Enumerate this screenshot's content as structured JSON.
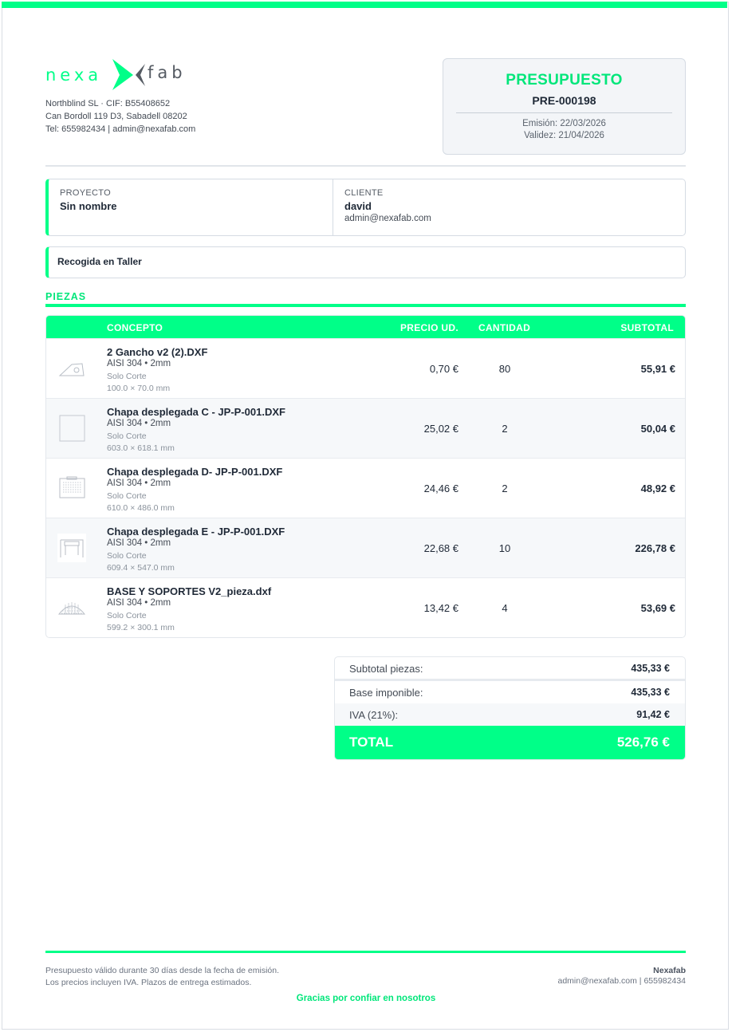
{
  "brand": {
    "logo_left": "nexa",
    "logo_right": "fab",
    "accent_color": "#00ff88"
  },
  "company": {
    "line1": "Northblind SL · CIF: B55408652",
    "line2": "Can Bordoll 119 D3, Sabadell 08202",
    "line3": "Tel: 655982434 | admin@nexafab.com"
  },
  "quote": {
    "title": "PRESUPUESTO",
    "number": "PRE-000198",
    "issued": "Emisión: 22/03/2026",
    "valid": "Validez: 21/04/2026"
  },
  "project": {
    "label": "PROYECTO",
    "value": "Sin nombre"
  },
  "client": {
    "label": "CLIENTE",
    "name": "david",
    "email": "admin@nexafab.com"
  },
  "shipping": {
    "method": "Recogida en Taller"
  },
  "parts_section": {
    "title": "PIEZAS"
  },
  "table": {
    "headers": {
      "concept": "CONCEPTO",
      "unit_price": "PRECIO UD.",
      "quantity": "CANTIDAD",
      "subtotal": "SUBTOTAL"
    },
    "rows": [
      {
        "name": "2 Gancho v2 (2).DXF",
        "material": "AISI 304 • 2mm",
        "process": "Solo Corte",
        "dimensions": "100.0 × 70.0 mm",
        "unit_price": "0,70 €",
        "quantity": "80",
        "subtotal": "55,91 €",
        "thumb_icon": "hook-part-icon"
      },
      {
        "name": "Chapa desplegada C - JP-P-001.DXF",
        "material": "AISI 304 • 2mm",
        "process": "Solo Corte",
        "dimensions": "603.0 × 618.1 mm",
        "unit_price": "25,02 €",
        "quantity": "2",
        "subtotal": "50,04 €",
        "thumb_icon": "square-sheet-icon"
      },
      {
        "name": "Chapa desplegada D- JP-P-001.DXF",
        "material": "AISI 304 • 2mm",
        "process": "Solo Corte",
        "dimensions": "610.0 × 486.0 mm",
        "unit_price": "24,46 €",
        "quantity": "2",
        "subtotal": "48,92 €",
        "thumb_icon": "perforated-sheet-icon"
      },
      {
        "name": "Chapa desplegada E - JP-P-001.DXF",
        "material": "AISI 304 • 2mm",
        "process": "Solo Corte",
        "dimensions": "609.4 × 547.0 mm",
        "unit_price": "22,68 €",
        "quantity": "10",
        "subtotal": "226,78 €",
        "thumb_icon": "bracket-sheet-icon"
      },
      {
        "name": "BASE Y SOPORTES V2_pieza.dxf",
        "material": "AISI 304 • 2mm",
        "process": "Solo Corte",
        "dimensions": "599.2 × 300.1 mm",
        "unit_price": "13,42 €",
        "quantity": "4",
        "subtotal": "53,69 €",
        "thumb_icon": "dome-grid-icon"
      }
    ]
  },
  "totals": {
    "subtotal_label": "Subtotal piezas:",
    "subtotal_value": "435,33 €",
    "base_label": "Base imponible:",
    "base_value": "435,33 €",
    "tax_label": "IVA (21%):",
    "tax_value": "91,42 €",
    "total_label": "TOTAL",
    "total_value": "526,76 €"
  },
  "footer": {
    "note1": "Presupuesto válido durante 30 días desde la fecha de emisión.",
    "note2": "Los precios incluyen IVA. Plazos de entrega estimados.",
    "brand": "Nexafab",
    "contact": "admin@nexafab.com | 655982434",
    "thanks": "Gracias por confiar en nosotros"
  }
}
